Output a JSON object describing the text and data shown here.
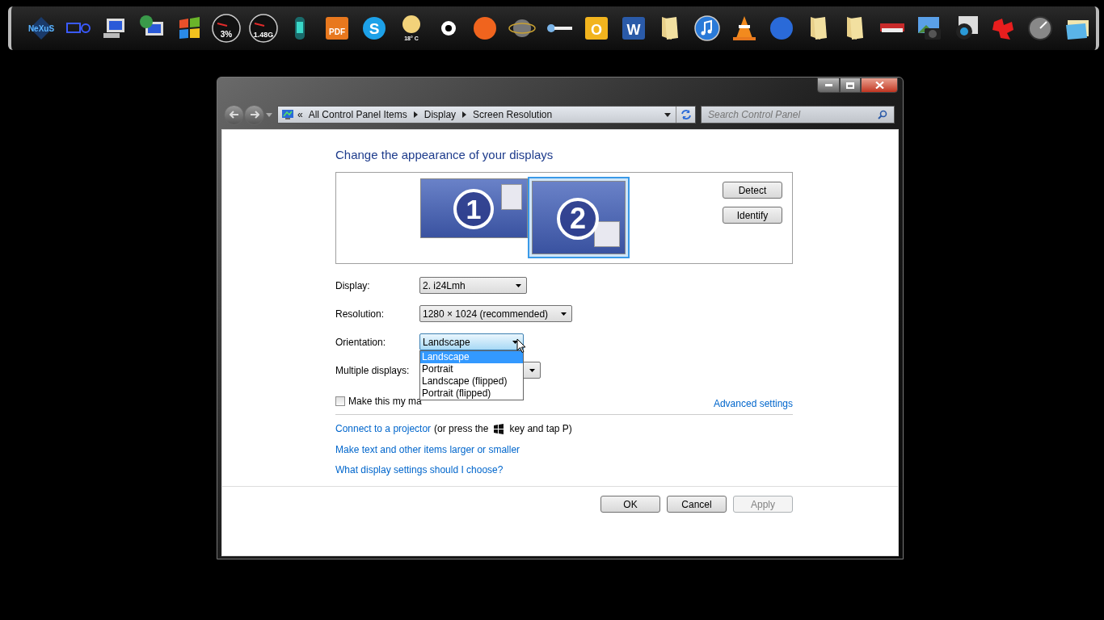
{
  "dock": [
    {
      "kind": "logo",
      "text": "NeXuS"
    },
    {
      "kind": "widget"
    },
    {
      "kind": "monitor"
    },
    {
      "kind": "globe-monitor"
    },
    {
      "kind": "flag"
    },
    {
      "kind": "gauge",
      "text": "3%"
    },
    {
      "kind": "gauge",
      "text": "1.48G"
    },
    {
      "kind": "cylinder"
    },
    {
      "kind": "tile",
      "text": "PDF",
      "color": "#e8781e"
    },
    {
      "kind": "round",
      "text": "S",
      "color": "#1da1e8"
    },
    {
      "kind": "weather",
      "text": "18° C"
    },
    {
      "kind": "ring"
    },
    {
      "kind": "round",
      "color": "#f0641e"
    },
    {
      "kind": "atom"
    },
    {
      "kind": "bar"
    },
    {
      "kind": "tile",
      "text": "O",
      "color": "#f2b41e"
    },
    {
      "kind": "tile",
      "text": "W",
      "color": "#2a5aa8"
    },
    {
      "kind": "folder"
    },
    {
      "kind": "note"
    },
    {
      "kind": "cone"
    },
    {
      "kind": "round",
      "color": "#2a6ad8"
    },
    {
      "kind": "folder"
    },
    {
      "kind": "folder"
    },
    {
      "kind": "book"
    },
    {
      "kind": "camera"
    },
    {
      "kind": "lens"
    },
    {
      "kind": "puzzle"
    },
    {
      "kind": "clock"
    },
    {
      "kind": "mail"
    }
  ],
  "address_bar": {
    "chevron": "«",
    "crumbs": [
      "All Control Panel Items",
      "Display",
      "Screen Resolution"
    ]
  },
  "search": {
    "placeholder": "Search Control Panel"
  },
  "heading": "Change the appearance of your displays",
  "monitors": [
    {
      "number": "1",
      "selected": false
    },
    {
      "number": "2",
      "selected": true
    }
  ],
  "monitor_buttons": [
    "Detect",
    "Identify"
  ],
  "settings": [
    {
      "label": "Display:",
      "value": "2. i24Lmh",
      "open": false
    },
    {
      "label": "Resolution:",
      "value": "1280 × 1024 (recommended)",
      "open": false
    },
    {
      "label": "Orientation:",
      "value": "Landscape",
      "open": true,
      "options": [
        {
          "label": "Landscape",
          "selected": true
        },
        {
          "label": "Portrait",
          "selected": false
        },
        {
          "label": "Landscape (flipped)",
          "selected": false
        },
        {
          "label": "Portrait (flipped)",
          "selected": false
        }
      ]
    },
    {
      "label": "Multiple displays:",
      "open": false
    }
  ],
  "main_display": {
    "label": "Make this my ma",
    "checked": false
  },
  "advanced_link": "Advanced settings",
  "projector": {
    "link": "Connect to a projector",
    "before_key": "(or press the",
    "after_key": "key and tap P)"
  },
  "links": [
    "Make text and other items larger or smaller",
    "What display settings should I choose?"
  ],
  "buttons": [
    {
      "label": "OK",
      "disabled": false
    },
    {
      "label": "Cancel",
      "disabled": false
    },
    {
      "label": "Apply",
      "disabled": true
    }
  ]
}
